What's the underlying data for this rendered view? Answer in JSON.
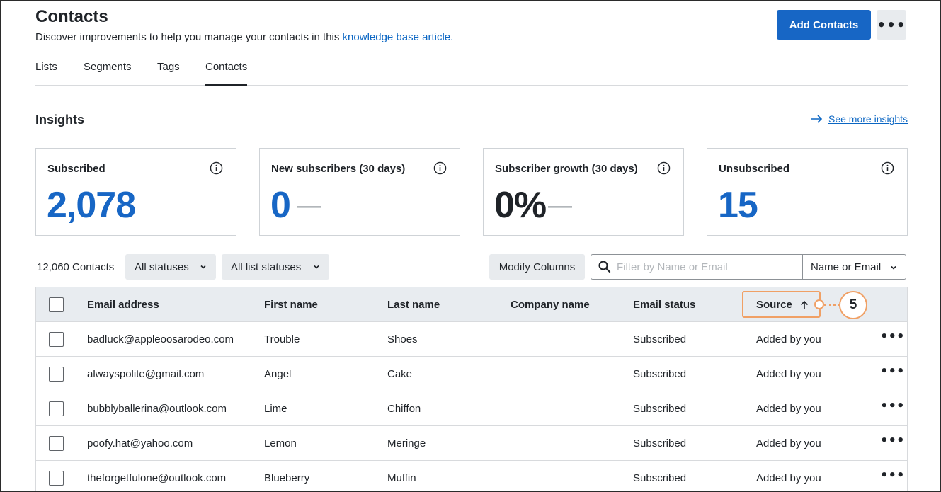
{
  "header": {
    "title": "Contacts",
    "subtitle_text": "Discover improvements to help you manage your contacts in this ",
    "subtitle_link": "knowledge base article.",
    "add_button": "Add Contacts",
    "more_button": "•••"
  },
  "tabs": [
    {
      "label": "Lists"
    },
    {
      "label": "Segments"
    },
    {
      "label": "Tags"
    },
    {
      "label": "Contacts",
      "active": true
    }
  ],
  "insights": {
    "title": "Insights",
    "see_more": "See more insights",
    "cards": [
      {
        "label": "Subscribed",
        "value": "2,078",
        "dash": ""
      },
      {
        "label": "New subscribers (30 days)",
        "value": "0",
        "dash": "—"
      },
      {
        "label": "Subscriber growth (30 days)",
        "value": "0%",
        "dash": "—"
      },
      {
        "label": "Unsubscribed",
        "value": "15",
        "dash": ""
      }
    ]
  },
  "filters": {
    "count": "12,060 Contacts",
    "status_dropdown": "All statuses",
    "list_status_dropdown": "All list statuses",
    "modify_columns": "Modify Columns",
    "search_placeholder": "Filter by Name or Email",
    "search_type": "Name or Email"
  },
  "table": {
    "columns": [
      "Email address",
      "First name",
      "Last name",
      "Company name",
      "Email status",
      "Source"
    ],
    "callout_number": "5",
    "rows": [
      {
        "email": "badluck@appleoosarodeo.com",
        "first": "Trouble",
        "last": "Shoes",
        "company": "",
        "status": "Subscribed",
        "source": "Added by you"
      },
      {
        "email": "alwayspolite@gmail.com",
        "first": "Angel",
        "last": "Cake",
        "company": "",
        "status": "Subscribed",
        "source": "Added by you"
      },
      {
        "email": "bubblyballerina@outlook.com",
        "first": "Lime",
        "last": "Chiffon",
        "company": "",
        "status": "Subscribed",
        "source": "Added by you"
      },
      {
        "email": "poofy.hat@yahoo.com",
        "first": "Lemon",
        "last": "Meringe",
        "company": "",
        "status": "Subscribed",
        "source": "Added by you"
      },
      {
        "email": "theforgetfulone@outlook.com",
        "first": "Blueberry",
        "last": "Muffin",
        "company": "",
        "status": "Subscribed",
        "source": "Added by you"
      }
    ],
    "row_more": "•••"
  },
  "colors": {
    "primary": "#1766c5",
    "link": "#0b66c3",
    "highlight": "#f0a065"
  }
}
